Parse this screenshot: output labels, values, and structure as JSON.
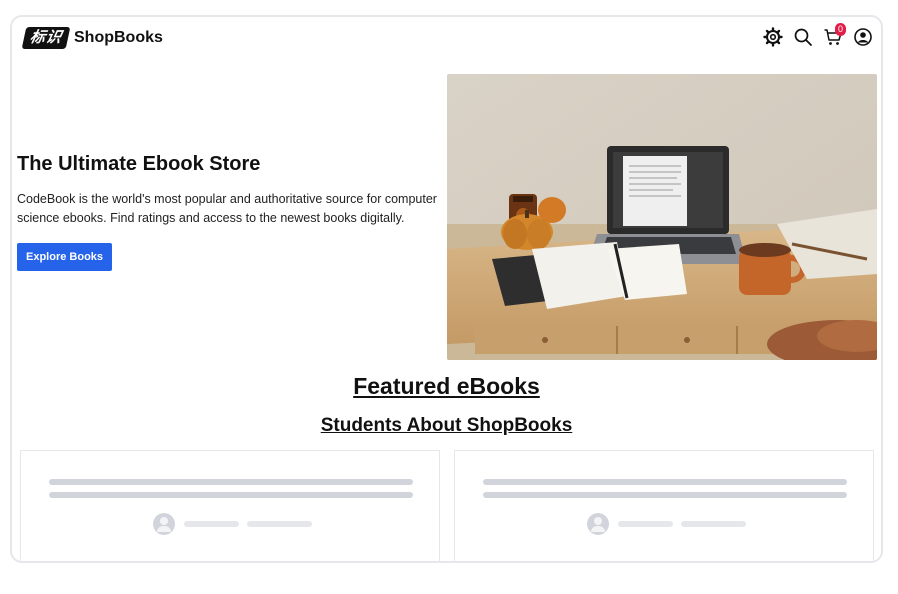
{
  "brand": {
    "logo_text": "标识",
    "name": "ShopBooks"
  },
  "header": {
    "icons": [
      "settings-icon",
      "search-icon",
      "cart-icon",
      "user-icon"
    ],
    "cart_count": "0"
  },
  "hero": {
    "title": "The Ultimate Ebook Store",
    "description": "CodeBook is the world's most popular and authoritative source for computer science ebooks. Find ratings and access to the newest books digitally.",
    "cta_label": "Explore Books"
  },
  "sections": {
    "featured_title": "Featured eBooks",
    "testimonials_title": "Students About ShopBooks"
  },
  "colors": {
    "accent": "#2563eb",
    "badge": "#e11d48",
    "skeleton": "#d1d5db"
  }
}
